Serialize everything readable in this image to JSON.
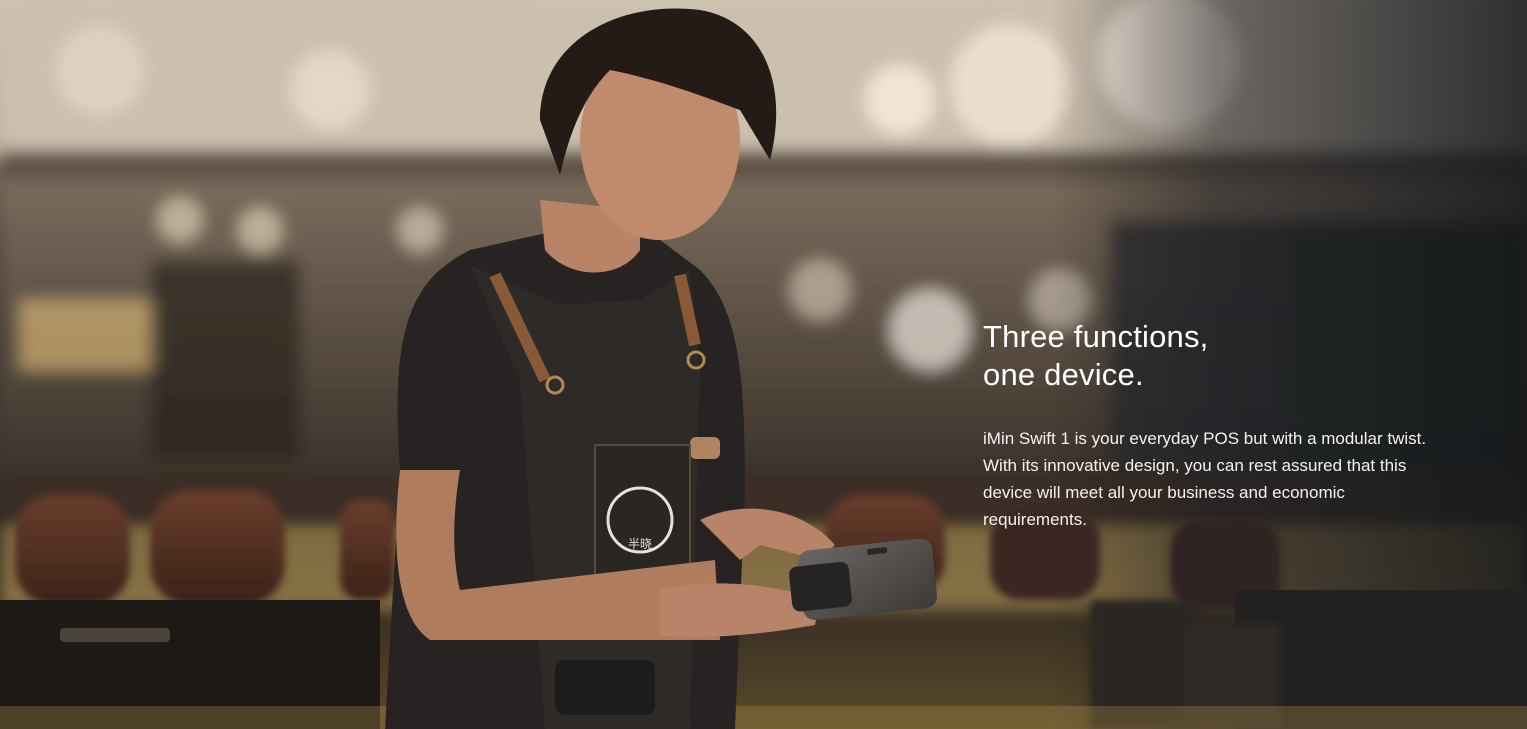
{
  "hero": {
    "headline_line1": "Three functions,",
    "headline_line2": "one device.",
    "body": "iMin Swift 1 is your everyday POS but with a modular twist. With its innovative design, you can rest assured that this device will meet all your business and economic requirements."
  },
  "apron_logo_text": "半晓"
}
